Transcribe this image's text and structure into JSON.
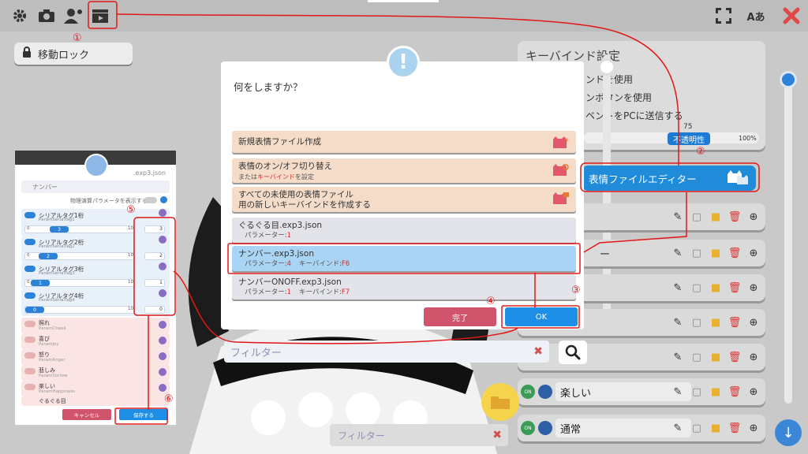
{
  "toolbar": {
    "icons": [
      "gear-icon",
      "camera-icon",
      "user-settings-icon",
      "clapperboard-icon"
    ],
    "right_icons": [
      "expand-icon",
      "language-icon",
      "close-icon"
    ],
    "language_label": "Aあ"
  },
  "lock_button": {
    "label": "移動ロック"
  },
  "keybind_panel": {
    "title": "キーバインド設定",
    "line1": "ンドを使用",
    "line2": "ンボタンを使用",
    "line3": "ベントをPCに送信する",
    "opacity_value": "75",
    "opacity_label": "不透明性",
    "opacity_percent": "100%"
  },
  "editor_button": {
    "label": "表情ファイルエディター"
  },
  "rows": [
    {
      "label": ""
    },
    {
      "label": "ー"
    },
    {
      "label": ""
    },
    {
      "label": ""
    },
    {
      "label": ""
    },
    {
      "label": "楽しい",
      "on": "ON"
    },
    {
      "label": "通常",
      "on": "ON"
    }
  ],
  "dialog": {
    "title": "何をしますか？",
    "options": [
      {
        "line1": "新規表情ファイル作成",
        "line2": ""
      },
      {
        "line1": "表情のオン/オフ切り替え",
        "sub_pre": "または",
        "sub_red": "キーバインド",
        "sub_post": "を設定"
      },
      {
        "line1": "すべての未使用の表情ファイル",
        "line2": "用の新しいキーバインドを作成する"
      }
    ],
    "files": [
      {
        "name": "ぐるぐる目.exp3.json",
        "param_label": "パラメーター:",
        "param_value": "1",
        "key_label": "",
        "key_value": ""
      },
      {
        "name": "ナンバー.exp3.json",
        "param_label": "パラメーター:",
        "param_value": "4",
        "key_label": "キーバインド:",
        "key_value": "F6"
      },
      {
        "name": "ナンバーONOFF.exp3.json",
        "param_label": "パラメーター:",
        "param_value": "1",
        "key_label": "キーバインド:",
        "key_value": "F7"
      }
    ],
    "done_label": "完了",
    "ok_label": "OK"
  },
  "filter_main": {
    "placeholder": "フィルター"
  },
  "filter_bottom": {
    "placeholder": "フィルター"
  },
  "left_panel": {
    "filename": ".exp3.json",
    "name_placeholder": "ナンバー",
    "physics_label": "物理演算パラメータを表示する",
    "params": [
      {
        "title": "シリアルタグ1桁",
        "id": "ParamSerialTag1",
        "value": "3",
        "min": "0",
        "max": "10"
      },
      {
        "title": "シリアルタグ2桁",
        "id": "ParamSerialTag2",
        "value": "2",
        "min": "0",
        "max": "10"
      },
      {
        "title": "シリアルタグ3桁",
        "id": "ParamSerialTag3",
        "value": "1",
        "min": "0",
        "max": "10"
      },
      {
        "title": "シリアルタグ4桁",
        "id": "ParamSerialTag4",
        "value": "0",
        "min": "0",
        "max": "10"
      }
    ],
    "inactive": [
      {
        "title": "照れ",
        "id": "ParamCheek"
      },
      {
        "title": "喜び",
        "id": "ParamJoy"
      },
      {
        "title": "怒り",
        "id": "ParamAnger"
      },
      {
        "title": "悲しみ",
        "id": "ParamSorrow"
      },
      {
        "title": "楽しい",
        "id": "ParamHappiness"
      },
      {
        "title": "ぐるぐる目",
        "id": ""
      }
    ],
    "cancel_label": "キャンセル",
    "save_label": "保存する"
  },
  "annotations": [
    "①",
    "②",
    "③",
    "④",
    "⑤",
    "⑥"
  ]
}
